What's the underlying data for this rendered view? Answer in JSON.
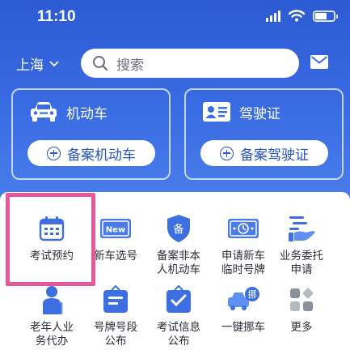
{
  "status_bar": {
    "time": "11:10"
  },
  "header": {
    "city": "上海",
    "search_placeholder": "搜索"
  },
  "cards": [
    {
      "title": "机动车",
      "button": "备案机动车"
    },
    {
      "title": "驾驶证",
      "button": "备案驾驶证"
    }
  ],
  "services": [
    {
      "label": "考试预约",
      "icon": "calendar-icon"
    },
    {
      "label": "新车选号",
      "icon": "new-plate-icon"
    },
    {
      "label": "备案非本人机动车",
      "icon": "shield-bei-icon"
    },
    {
      "label": "申请新车临时号牌",
      "icon": "temp-plate-icon"
    },
    {
      "label": "业务委托申请",
      "icon": "delegate-icon"
    },
    {
      "label": "老年人业务代办",
      "icon": "elderly-icon"
    },
    {
      "label": "号牌号段公布",
      "icon": "plate-range-icon"
    },
    {
      "label": "考试信息公布",
      "icon": "exam-info-icon"
    },
    {
      "label": "一键挪车",
      "icon": "move-car-icon"
    },
    {
      "label": "更多",
      "icon": "more-icon"
    }
  ],
  "colors": {
    "brand_blue": "#2c5bd4",
    "highlight": "#e9569a"
  }
}
